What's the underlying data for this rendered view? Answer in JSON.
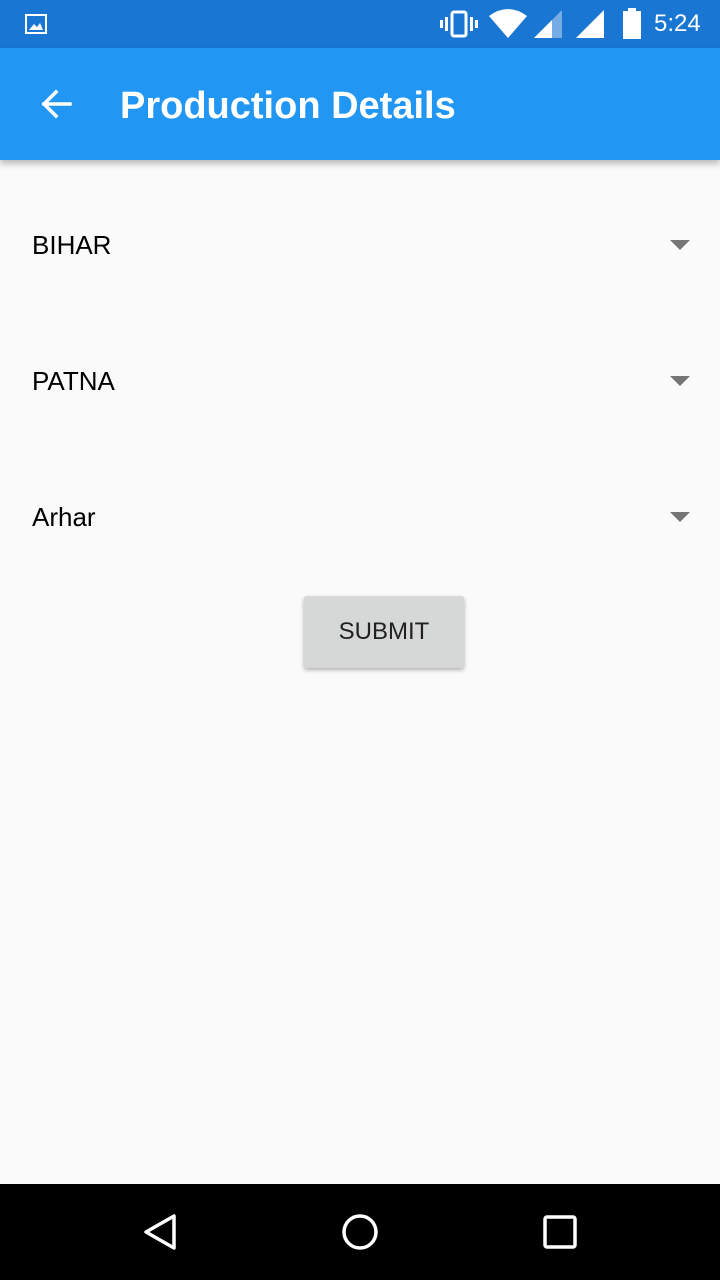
{
  "status_bar": {
    "time": "5:24",
    "icons": [
      "gallery-notification-icon",
      "vibrate-icon",
      "wifi-icon",
      "cell-signal-icon",
      "cell-signal-icon",
      "battery-icon"
    ],
    "color": "#1976d2"
  },
  "app_bar": {
    "title": "Production Details",
    "back_icon": "arrow-back-icon",
    "color": "#2196f3"
  },
  "form": {
    "state_spinner": {
      "value": "BIHAR"
    },
    "district_spinner": {
      "value": "PATNA"
    },
    "crop_spinner": {
      "value": "Arhar"
    },
    "submit_label": "SUBMIT"
  },
  "nav_bar": {
    "buttons": [
      "back-triangle-icon",
      "home-circle-icon",
      "recents-square-icon"
    ]
  }
}
